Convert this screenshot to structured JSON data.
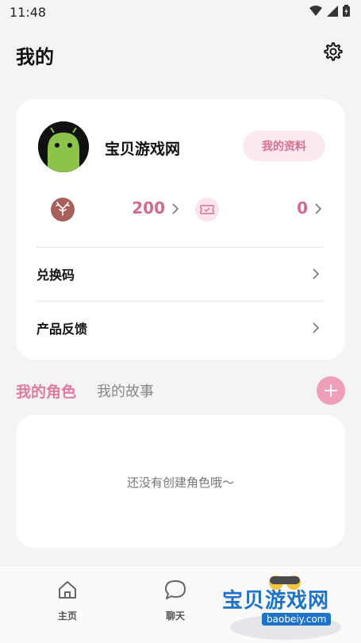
{
  "status_bar": {
    "time": "11:48"
  },
  "header": {
    "title": "我的"
  },
  "profile": {
    "username": "宝贝游戏网",
    "profile_button": "我的资料"
  },
  "stats": {
    "coins": "200",
    "tickets": "0"
  },
  "menu": {
    "redeem": "兑换码",
    "feedback": "产品反馈"
  },
  "tabs": {
    "active": "我的角色",
    "inactive": "我的故事"
  },
  "roles": {
    "empty_text": "还没有创建角色哦～"
  },
  "bottom_nav": {
    "home": "主页",
    "chat": "聊天"
  },
  "watermark": {
    "text": "宝贝游戏网",
    "url": "baobeiy.com"
  },
  "colors": {
    "accent": "#d06b8c",
    "accent_light": "#fce8ef",
    "add_button": "#ef9fbc",
    "background": "#f4f4f4"
  },
  "icons": {
    "settings": "gear-icon",
    "coins": "antler-coin-icon",
    "tickets": "ticket-icon",
    "chevron": "chevron-right-icon",
    "add": "plus-icon",
    "home": "home-icon",
    "chat": "chat-bubble-icon"
  }
}
